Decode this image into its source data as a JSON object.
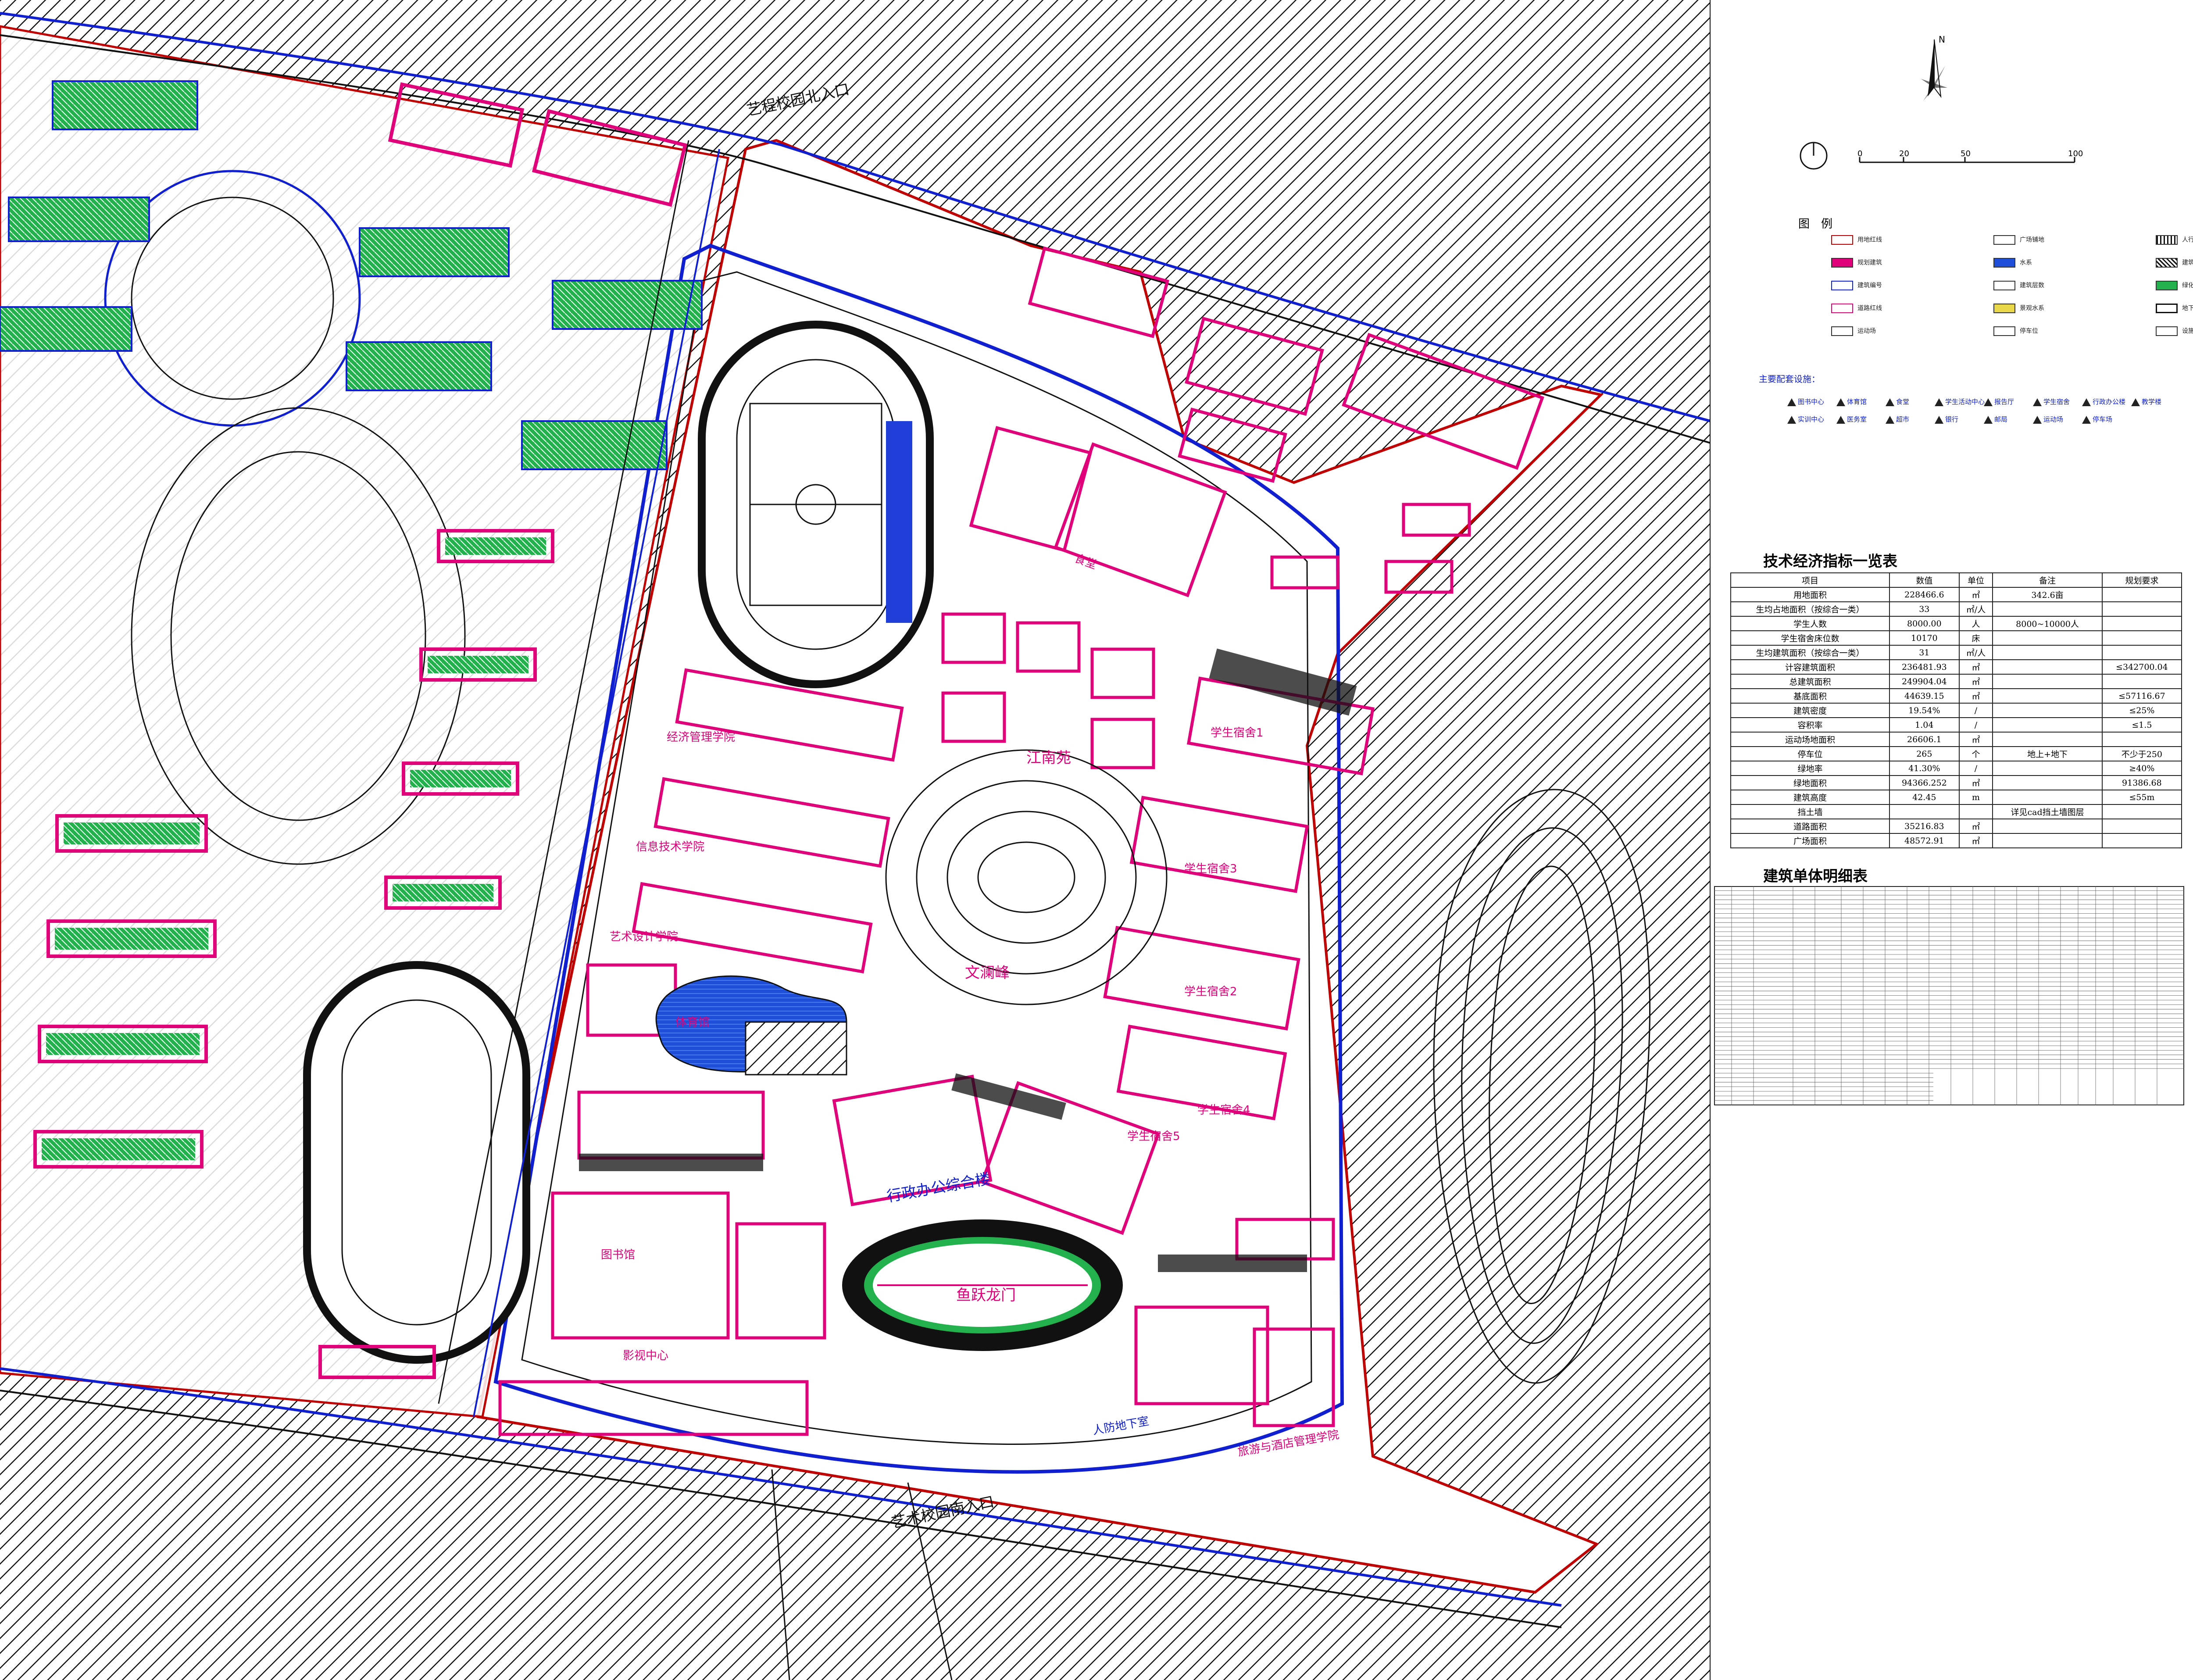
{
  "map": {
    "colors": {
      "hatch": "#111111",
      "pink": "#e0007a",
      "blue": "#1020d0",
      "green": "#22b14c",
      "water": "#1f4fd8",
      "red": "#c00000"
    },
    "labels": [
      {
        "id": "north-entrance",
        "text": "艺程校园北入口",
        "color": "black"
      },
      {
        "id": "south-entrance",
        "text": "艺术校园南入口",
        "color": "black"
      },
      {
        "id": "jiangnan-garden",
        "text": "江南苑",
        "color": "pink"
      },
      {
        "id": "wenxiu-peak",
        "text": "文澜峰",
        "color": "pink"
      },
      {
        "id": "yuyue-longmen",
        "text": "鱼跃龙门",
        "color": "pink"
      },
      {
        "id": "admin-complex",
        "text": "行政办公综合楼",
        "color": "blue"
      },
      {
        "id": "art-design-school",
        "text": "艺术设计学院",
        "color": "pink"
      },
      {
        "id": "info-tech-school",
        "text": "信息技术学院",
        "color": "pink"
      },
      {
        "id": "economic-mgmt-school",
        "text": "经济管理学院",
        "color": "pink"
      },
      {
        "id": "dorm-1",
        "text": "学生宿舍1",
        "color": "pink"
      },
      {
        "id": "dorm-2",
        "text": "学生宿舍2",
        "color": "pink"
      },
      {
        "id": "dorm-3",
        "text": "学生宿舍3",
        "color": "pink"
      },
      {
        "id": "dorm-4",
        "text": "学生宿舍4",
        "color": "pink"
      },
      {
        "id": "dorm-5",
        "text": "学生宿舍5",
        "color": "pink"
      },
      {
        "id": "civil-defense",
        "text": "人防地下室",
        "color": "blue"
      },
      {
        "id": "library",
        "text": "图书馆",
        "color": "pink"
      },
      {
        "id": "tourism-hotel-school",
        "text": "旅游与酒店管理学院",
        "color": "pink"
      },
      {
        "id": "drama-center",
        "text": "影视中心",
        "color": "pink"
      },
      {
        "id": "canteen",
        "text": "食堂",
        "color": "pink"
      },
      {
        "id": "gym",
        "text": "体育馆",
        "color": "pink"
      }
    ]
  },
  "north": {
    "letter": "N"
  },
  "scale": {
    "ticks": [
      "0",
      "20",
      "50",
      "100"
    ]
  },
  "legend": {
    "title": "图　例",
    "items": [
      "用地红线",
      "广场铺地",
      "人行步道",
      "规划建筑",
      "水系",
      "建筑出入口",
      "建筑编号",
      "建筑层数",
      "绿化",
      "道路红线",
      "景观水系",
      "地下车库",
      "运动场",
      "停车位",
      "设施编号"
    ]
  },
  "facilities": {
    "title": "主要配套设施：",
    "items": [
      "图书中心",
      "体育馆",
      "食堂",
      "学生活动中心",
      "报告厅",
      "学生宿舍",
      "行政办公楼",
      "教学楼",
      "实训中心",
      "医务室",
      "超市",
      "银行",
      "邮局",
      "运动场",
      "停车场"
    ]
  },
  "tech_table": {
    "title": "技术经济指标一览表",
    "headers": [
      "项目",
      "数值",
      "单位",
      "备注",
      "规划要求"
    ],
    "rows": [
      [
        "用地面积",
        "228466.6",
        "㎡",
        "342.6亩",
        ""
      ],
      [
        "生均占地面积（按综合一类）",
        "33",
        "㎡/人",
        "",
        ""
      ],
      [
        "学生人数",
        "8000.00",
        "人",
        "8000~10000人",
        ""
      ],
      [
        "学生宿舍床位数",
        "10170",
        "床",
        "",
        ""
      ],
      [
        "生均建筑面积（按综合一类）",
        "31",
        "㎡/人",
        "",
        ""
      ],
      [
        "计容建筑面积",
        "236481.93",
        "㎡",
        "",
        "≤342700.04"
      ],
      [
        "总建筑面积",
        "249904.04",
        "㎡",
        "",
        ""
      ],
      [
        "基底面积",
        "44639.15",
        "㎡",
        "",
        "≤57116.67"
      ],
      [
        "建筑密度",
        "19.54%",
        "/",
        "",
        "≤25%"
      ],
      [
        "容积率",
        "1.04",
        "/",
        "",
        "≤1.5"
      ],
      [
        "运动场地面积",
        "26606.1",
        "㎡",
        "",
        ""
      ],
      [
        "停车位",
        "265",
        "个",
        "地上+地下",
        "不少于250"
      ],
      [
        "绿地率",
        "41.30%",
        "/",
        "",
        "≥40%"
      ],
      [
        "绿地面积",
        "94366.252",
        "㎡",
        "",
        "91386.68"
      ],
      [
        "建筑高度",
        "42.45",
        "m",
        "",
        "≤55m"
      ],
      [
        "挡土墙",
        "",
        "",
        "详见cad挡土墙图层",
        ""
      ],
      [
        "道路面积",
        "35216.83",
        "㎡",
        "",
        ""
      ],
      [
        "广场面积",
        "48572.91",
        "㎡",
        "",
        ""
      ]
    ]
  },
  "building_table": {
    "title": "建筑单体明细表"
  }
}
